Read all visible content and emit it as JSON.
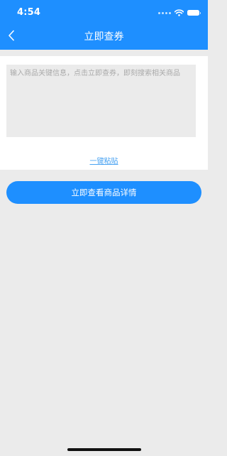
{
  "status_bar": {
    "time": "4:54",
    "icons": [
      "signal-dots-icon",
      "wifi-icon",
      "battery-icon"
    ]
  },
  "nav": {
    "back_icon": "chevron-left-icon",
    "title": "立即查券"
  },
  "search": {
    "placeholder": "输入商品关键信息，点击立即查券，即刻搜索相关商品",
    "value": ""
  },
  "paste_link": {
    "label": "一键粘贴"
  },
  "actions": {
    "view_details_label": "立即查看商品详情"
  },
  "colors": {
    "primary": "#1e8fff",
    "background": "#ebebeb",
    "panel": "#ffffff",
    "link": "#4aa3f2",
    "placeholder": "#aaaaaa"
  }
}
